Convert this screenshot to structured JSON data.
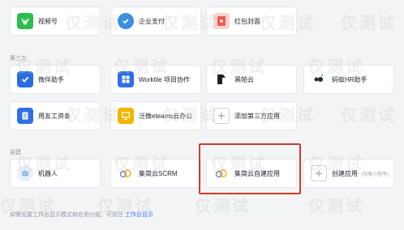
{
  "top_row": [
    {
      "label": "视频号",
      "icon": "video-channel-icon",
      "color": "#2bbf4f"
    },
    {
      "label": "企业支付",
      "icon": "payment-icon",
      "color": "#3b8fe0"
    },
    {
      "label": "红包封面",
      "icon": "red-packet-icon",
      "color": "#e85d52"
    }
  ],
  "sections": {
    "third_party": "第三方",
    "custom": "自建"
  },
  "third_party_row1": [
    {
      "label": "微伴助手",
      "icon": "checkmark-icon",
      "color": "#2b6de0"
    },
    {
      "label": "Worktile 项目协作",
      "icon": "grid-icon",
      "color": "#2e6fe6"
    },
    {
      "label": "黑帕云",
      "icon": "black-logo-icon",
      "color": "#222222"
    },
    {
      "label": "蚂蚁HR助手",
      "icon": "ant-icon",
      "color": "#2a2a2a"
    }
  ],
  "third_party_row2": [
    {
      "label": "用友工资条",
      "icon": "document-icon",
      "color": "#2f6fe8"
    },
    {
      "label": "泛微eteams云办公",
      "icon": "monitor-icon",
      "color": "#f4b400"
    },
    {
      "label": "添加第三方应用",
      "icon": "plus-icon",
      "color": "#a0a4aa"
    }
  ],
  "custom_row": [
    {
      "label": "机器人",
      "icon": "robot-icon",
      "color": "#8fb4e6"
    },
    {
      "label": "集简云SCRM",
      "icon": "cloud-icon",
      "color": "#6f7fe0"
    },
    {
      "label": "集简云自建应用",
      "icon": "cloud-icon",
      "color": "#6f7fe0"
    },
    {
      "label": "创建应用",
      "sub": "(仅限小程序)",
      "icon": "plus-icon",
      "color": "#a0a4aa"
    }
  ],
  "footer": {
    "text": "如需设置工作台显示模式和应用分组，可前往 ",
    "link": "工作台显示"
  },
  "watermark": "仅测试"
}
